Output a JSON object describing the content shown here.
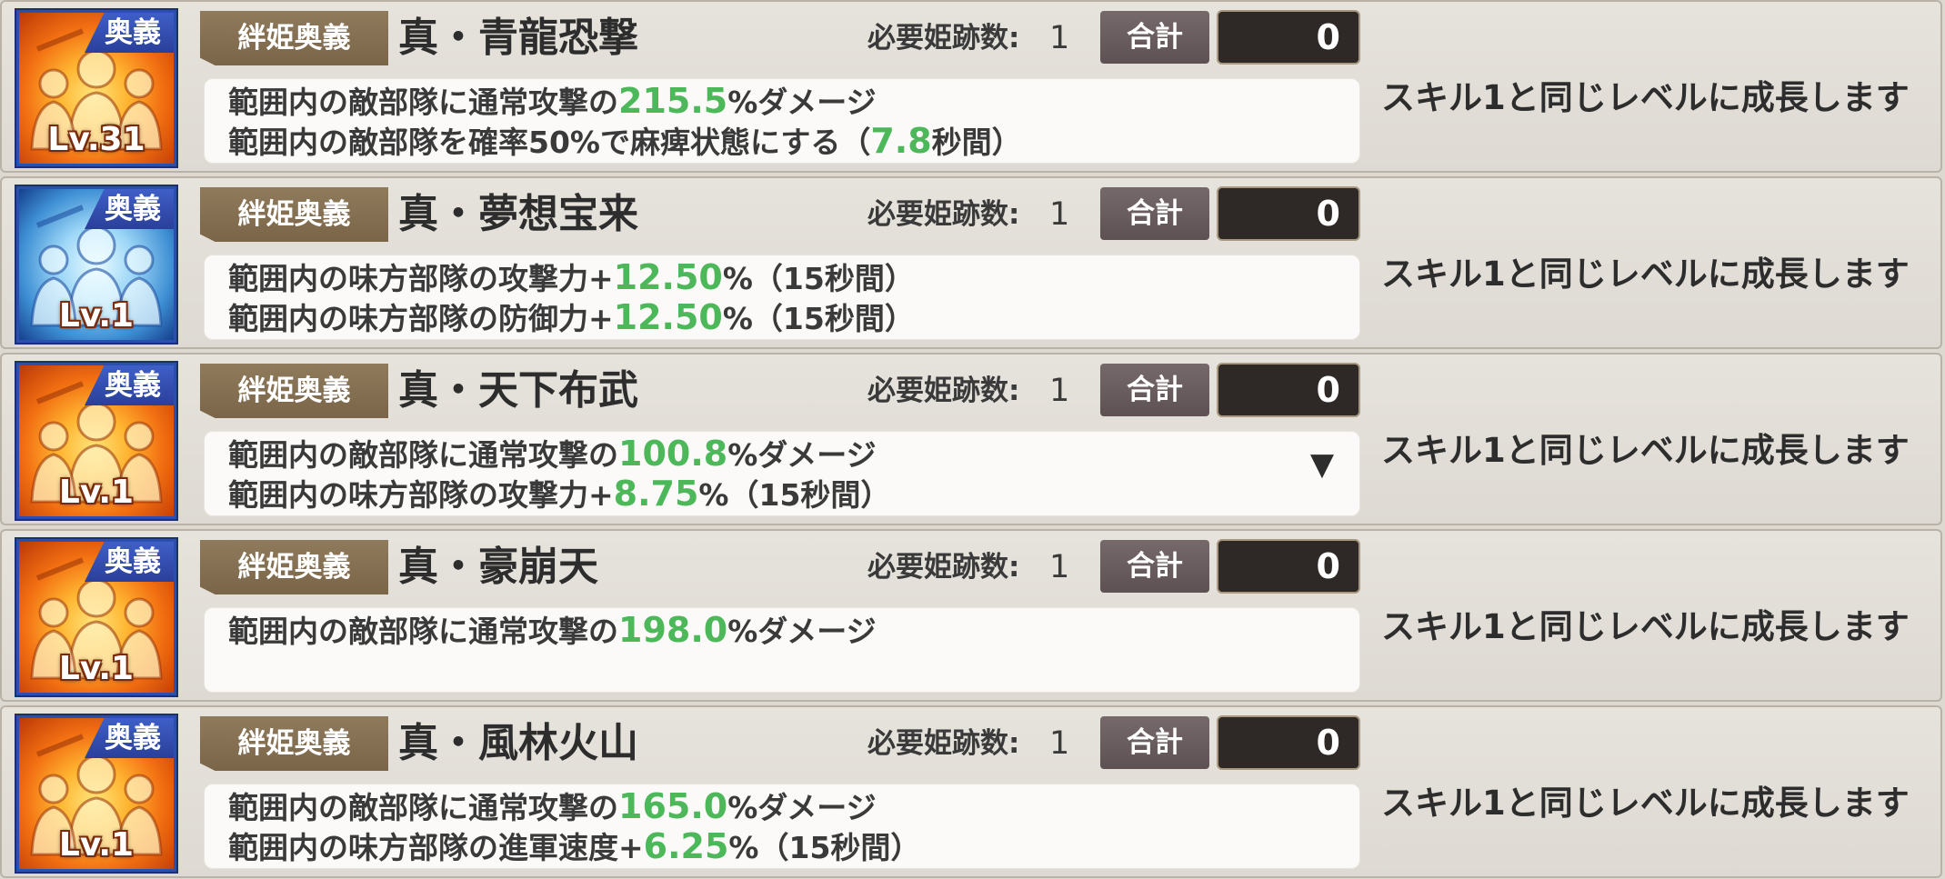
{
  "labels": {
    "ougi": "奥義",
    "type": "絆姫奥義",
    "required": "必要姫跡数:",
    "sum": "合計",
    "growth": "スキル1と同じレベルに成長します"
  },
  "colors": {
    "highlight_value": "#4cb85a",
    "ougi_badge": "#3352b8",
    "type_tag": "#86714f",
    "sum_box": "#2e2826"
  },
  "skills": [
    {
      "icon": "fire-warriors-icon",
      "level": "Lv.31",
      "name": "真・青龍恐撃",
      "required": "1",
      "sum": "0",
      "lines": [
        {
          "pre": "範囲内の敵部隊に通常攻撃の",
          "val": "215.5",
          "post": "%ダメージ"
        },
        {
          "pre": "範囲内の敵部隊を確率50%で麻痺状態にする（",
          "val": "7.8",
          "post": "秒間）"
        }
      ]
    },
    {
      "icon": "ice-warriors-icon",
      "level": "Lv.1",
      "name": "真・夢想宝来",
      "required": "1",
      "sum": "0",
      "lines": [
        {
          "pre": "範囲内の味方部隊の攻撃力+",
          "val": "12.50",
          "post": "%（15秒間）"
        },
        {
          "pre": "範囲内の味方部隊の防御力+",
          "val": "12.50",
          "post": "%（15秒間）"
        }
      ]
    },
    {
      "icon": "fire-warriors-icon",
      "level": "Lv.1",
      "name": "真・天下布武",
      "required": "1",
      "sum": "0",
      "lines": [
        {
          "pre": "範囲内の敵部隊に通常攻撃の",
          "val": "100.8",
          "post": "%ダメージ"
        },
        {
          "pre": "範囲内の味方部隊の攻撃力+",
          "val": "8.75",
          "post": "%（15秒間）"
        }
      ],
      "arrow": "▼"
    },
    {
      "icon": "fire-warriors-icon",
      "level": "Lv.1",
      "name": "真・豪崩天",
      "required": "1",
      "sum": "0",
      "lines": [
        {
          "pre": "範囲内の敵部隊に通常攻撃の",
          "val": "198.0",
          "post": "%ダメージ"
        }
      ]
    },
    {
      "icon": "fire-warriors-icon",
      "level": "Lv.1",
      "name": "真・風林火山",
      "required": "1",
      "sum": "0",
      "lines": [
        {
          "pre": "範囲内の敵部隊に通常攻撃の",
          "val": "165.0",
          "post": "%ダメージ"
        },
        {
          "pre": "範囲内の味方部隊の進軍速度+",
          "val": "6.25",
          "post": "%（15秒間）"
        }
      ]
    }
  ]
}
